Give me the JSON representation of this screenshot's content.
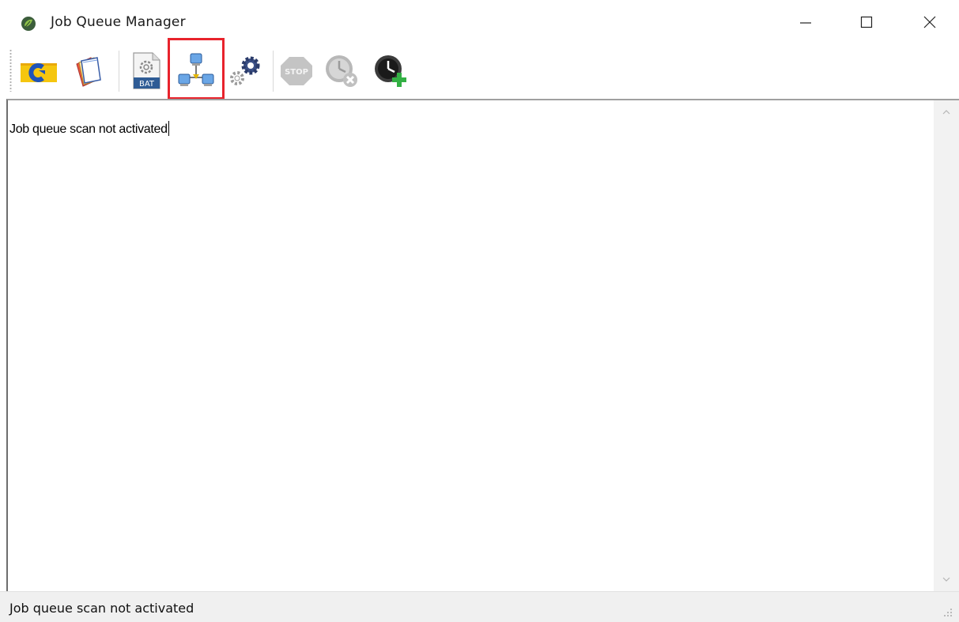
{
  "window": {
    "title": "Job Queue Manager",
    "icon": "app-leaf-icon"
  },
  "toolbar": {
    "buttons": [
      {
        "name": "open-config",
        "icon": "yellow-c-icon",
        "enabled": true
      },
      {
        "name": "documents",
        "icon": "pages-icon",
        "enabled": true
      },
      {
        "name": "batch",
        "icon": "bat-file-icon",
        "label": "BAT",
        "enabled": true
      },
      {
        "name": "network",
        "icon": "network-computers-icon",
        "enabled": true,
        "highlighted": true
      },
      {
        "name": "settings",
        "icon": "gears-icon",
        "enabled": true
      },
      {
        "name": "stop",
        "icon": "stop-icon",
        "label": "STOP",
        "enabled": false
      },
      {
        "name": "remove-schedule",
        "icon": "clock-remove-icon",
        "enabled": false
      },
      {
        "name": "add-schedule",
        "icon": "clock-add-icon",
        "enabled": true
      }
    ]
  },
  "content": {
    "log": "Job queue scan not activated"
  },
  "statusbar": {
    "text": "Job queue scan not activated"
  },
  "colors": {
    "highlight": "#e8232c",
    "statusbar_bg": "#f0f0f0"
  }
}
